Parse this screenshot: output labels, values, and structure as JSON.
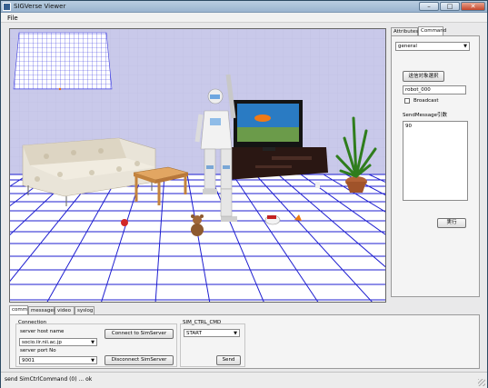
{
  "window": {
    "title": "SIGVerse Viewer",
    "minimize_glyph": "–",
    "maximize_glyph": "□",
    "close_glyph": "✕"
  },
  "menu": {
    "file": "File"
  },
  "right_panel": {
    "tabs": [
      "Attributes",
      "Command"
    ],
    "active_tab": "Command",
    "mode_select": "general",
    "select_target_button": "送信対象選択",
    "target_field": "robot_000",
    "broadcast_label": "Broadcast",
    "broadcast_checked": false,
    "message_arg_label": "SendMessage引数",
    "message_arg_value": "90",
    "execute_button": "実行"
  },
  "bottom_panel": {
    "tabs": [
      "comm",
      "messages",
      "video",
      "syslog"
    ],
    "active_tab": "comm",
    "connection": {
      "group_label": "Connection",
      "host_label": "server host name",
      "host_value": "socio.iir.nii.ac.jp",
      "port_label": "server port No",
      "port_value": "9001",
      "connect_button": "Connect to SimServer",
      "disconnect_button": "Disconnect SimServer"
    },
    "sim_ctrl": {
      "group_label": "SIM_CTRL_CMD",
      "command_value": "START",
      "send_button": "Send"
    }
  },
  "status_bar": {
    "text": "send SimCtrlCommand (0) ... ok"
  },
  "colors": {
    "floor_grid": "#1c1ccc",
    "wall": "#c7c7e8",
    "titlebar": "#9ab4cf"
  }
}
